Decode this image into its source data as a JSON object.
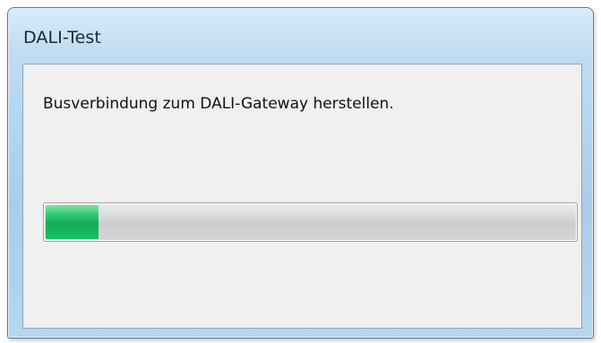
{
  "window": {
    "title": "DALI-Test"
  },
  "dialog": {
    "message": "Busverbindung zum DALI-Gateway herstellen."
  },
  "progress": {
    "value_percent": 10,
    "fill_color": "#12b35a"
  }
}
